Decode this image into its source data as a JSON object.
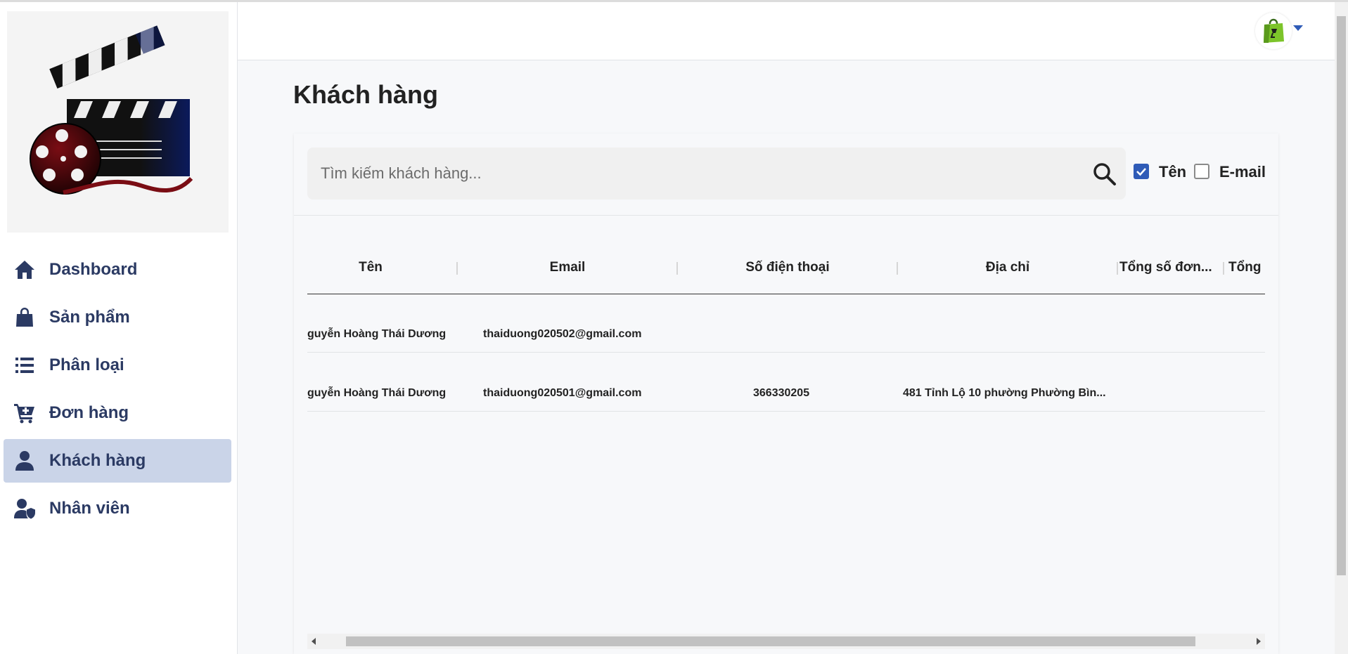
{
  "sidebar": {
    "logo": "film-clapperboard-logo",
    "items": [
      {
        "label": "Dashboard",
        "icon": "home-icon"
      },
      {
        "label": "Sản phẩm",
        "icon": "shopping-bag-icon"
      },
      {
        "label": "Phân loại",
        "icon": "list-icon"
      },
      {
        "label": "Đơn hàng",
        "icon": "cart-plus-icon"
      },
      {
        "label": "Khách hàng",
        "icon": "user-icon",
        "active": true
      },
      {
        "label": "Nhân viên",
        "icon": "user-shield-icon"
      }
    ]
  },
  "header": {
    "avatar_icon": "shopping-bag-avatar-icon",
    "dropdown_icon": "caret-down-icon"
  },
  "main": {
    "title": "Khách hàng",
    "search": {
      "placeholder": "Tìm kiếm khách hàng...",
      "value": ""
    },
    "filters": [
      {
        "label": "Tên",
        "checked": true
      },
      {
        "label": "E-mail",
        "checked": false
      }
    ],
    "table": {
      "columns": [
        "Tên",
        "Email",
        "Số điện thoại",
        "Địa chỉ",
        "Tổng số đơn...",
        "Tổng"
      ],
      "rows": [
        {
          "name": "guyễn Hoàng Thái Dương",
          "email": "thaiduong020502@gmail.com",
          "phone": "",
          "address": ""
        },
        {
          "name": "guyễn Hoàng Thái Dương",
          "email": "thaiduong020501@gmail.com",
          "phone": "366330205",
          "address": "481 Tỉnh Lộ 10 phường Phường Bìn..."
        }
      ]
    }
  },
  "colors": {
    "accent": "#2f5bb7",
    "nav_text": "#2b3a63",
    "nav_active_bg": "#cad4e8",
    "page_bg": "#f7f8fa"
  }
}
